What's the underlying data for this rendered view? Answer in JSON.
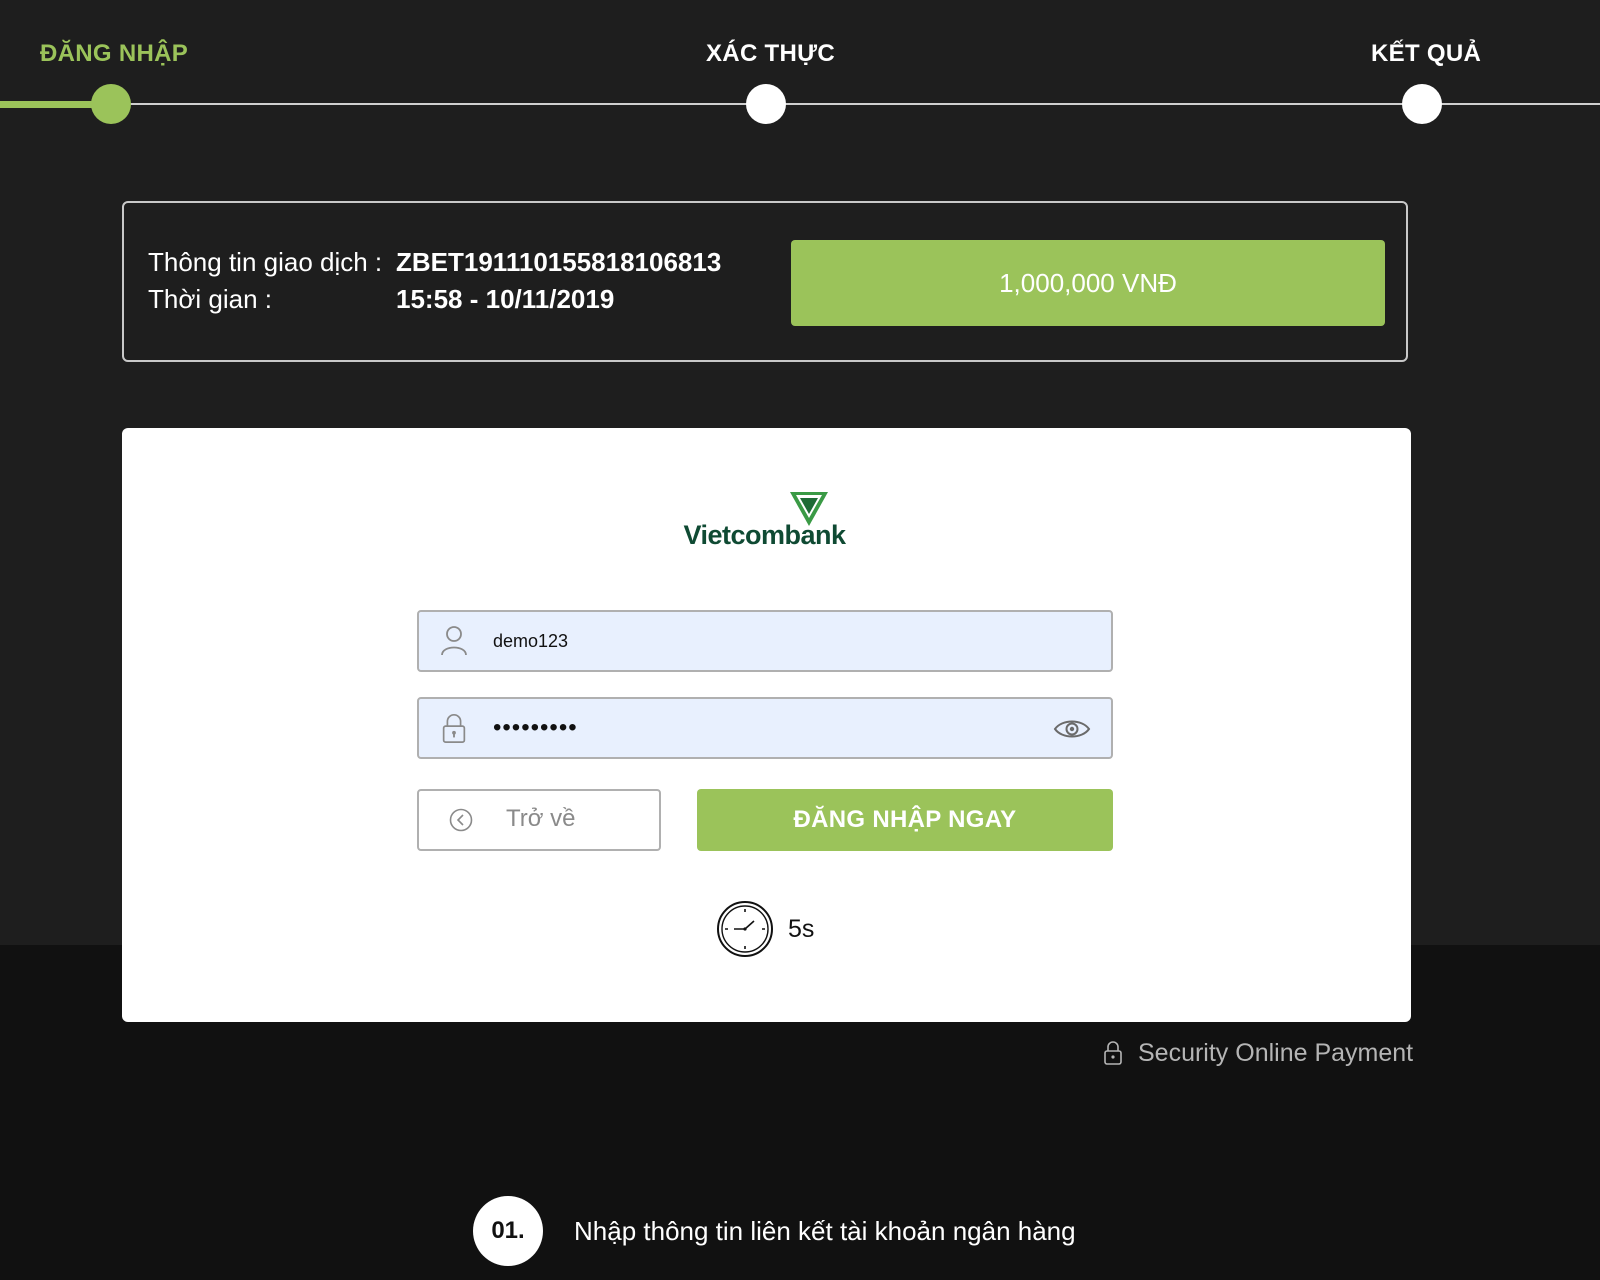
{
  "stepper": {
    "steps": [
      {
        "label": "ĐĂNG NHẬP",
        "state": "active"
      },
      {
        "label": "XÁC THỰC",
        "state": "pending"
      },
      {
        "label": "KẾT QUẢ",
        "state": "pending"
      }
    ]
  },
  "transaction": {
    "info_label": "Thông tin giao dịch :",
    "info_value": "ZBET191110155818106813",
    "time_label": "Thời gian :",
    "time_value": "15:58 - 10/11/2019",
    "amount": "1,000,000 VNĐ"
  },
  "bank": {
    "logo_text": "Vietcombank"
  },
  "form": {
    "username_value": "demo123",
    "password_value": "•••••••••",
    "back_label": "Trở về",
    "submit_label": "ĐĂNG NHẬP NGAY",
    "timer": "5s"
  },
  "footer": {
    "security_text": "Security Online Payment",
    "guide_number": "01.",
    "guide_text": "Nhập thông tin liên kết tài khoản ngân hàng"
  },
  "colors": {
    "accent": "#9bc35a",
    "background_dark": "#1e1e1e",
    "background_darker": "#111111",
    "input_bg": "#e8f0fe",
    "brand_green": "#0f4a33"
  }
}
